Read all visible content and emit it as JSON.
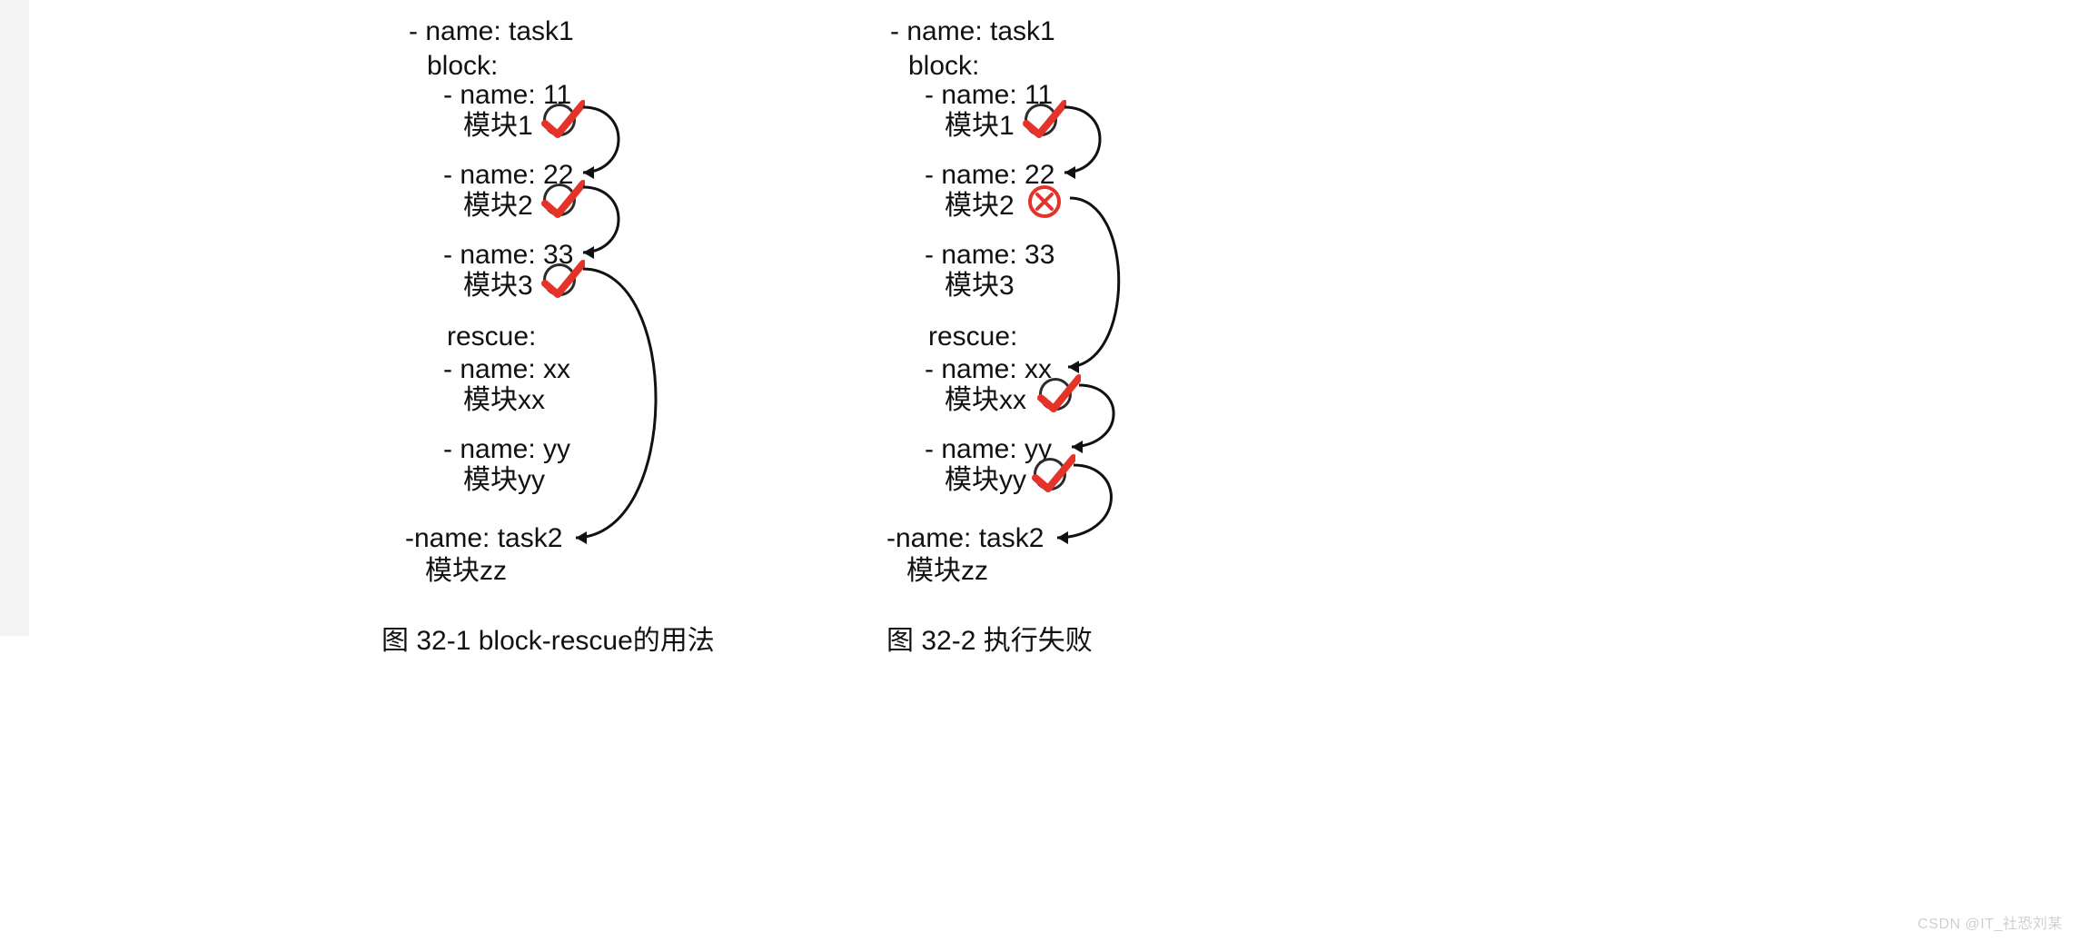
{
  "left_gutter": true,
  "diagrams": {
    "left": {
      "caption": "图 32-1 block-rescue的用法",
      "lines": {
        "task1": "- name: task1",
        "block": "block:",
        "n11": "- name: 11",
        "m1": "模块1",
        "n22": "- name: 22",
        "m2": "模块2",
        "n33": "- name: 33",
        "m3": "模块3",
        "rescue": "rescue:",
        "nxx": "- name: xx",
        "mxx": "模块xx",
        "nyy": "- name: yy",
        "myy": "模块yy",
        "task2": "-name: task2",
        "mzz": "模块zz"
      },
      "marks": {
        "m1": "check",
        "m2": "check",
        "m3": "check"
      },
      "arrows": [
        "m1-n22",
        "m2-n33",
        "m3-task2"
      ]
    },
    "right": {
      "caption": "图 32-2 执行失败",
      "lines": {
        "task1": "- name: task1",
        "block": "block:",
        "n11": "- name: 11",
        "m1": "模块1",
        "n22": "- name: 22",
        "m2": "模块2",
        "n33": "- name: 33",
        "m3": "模块3",
        "rescue": "rescue:",
        "nxx": "- name: xx",
        "mxx": "模块xx",
        "nyy": "- name: yy",
        "myy": "模块yy",
        "task2": "-name: task2",
        "mzz": "模块zz"
      },
      "marks": {
        "m1": "check",
        "m2": "cross",
        "mxx": "check",
        "myy": "check"
      },
      "arrows": [
        "m1-n22",
        "m2-nxx",
        "mxx-nyy",
        "myy-task2"
      ]
    }
  },
  "watermark": "CSDN @IT_社恐刘某"
}
